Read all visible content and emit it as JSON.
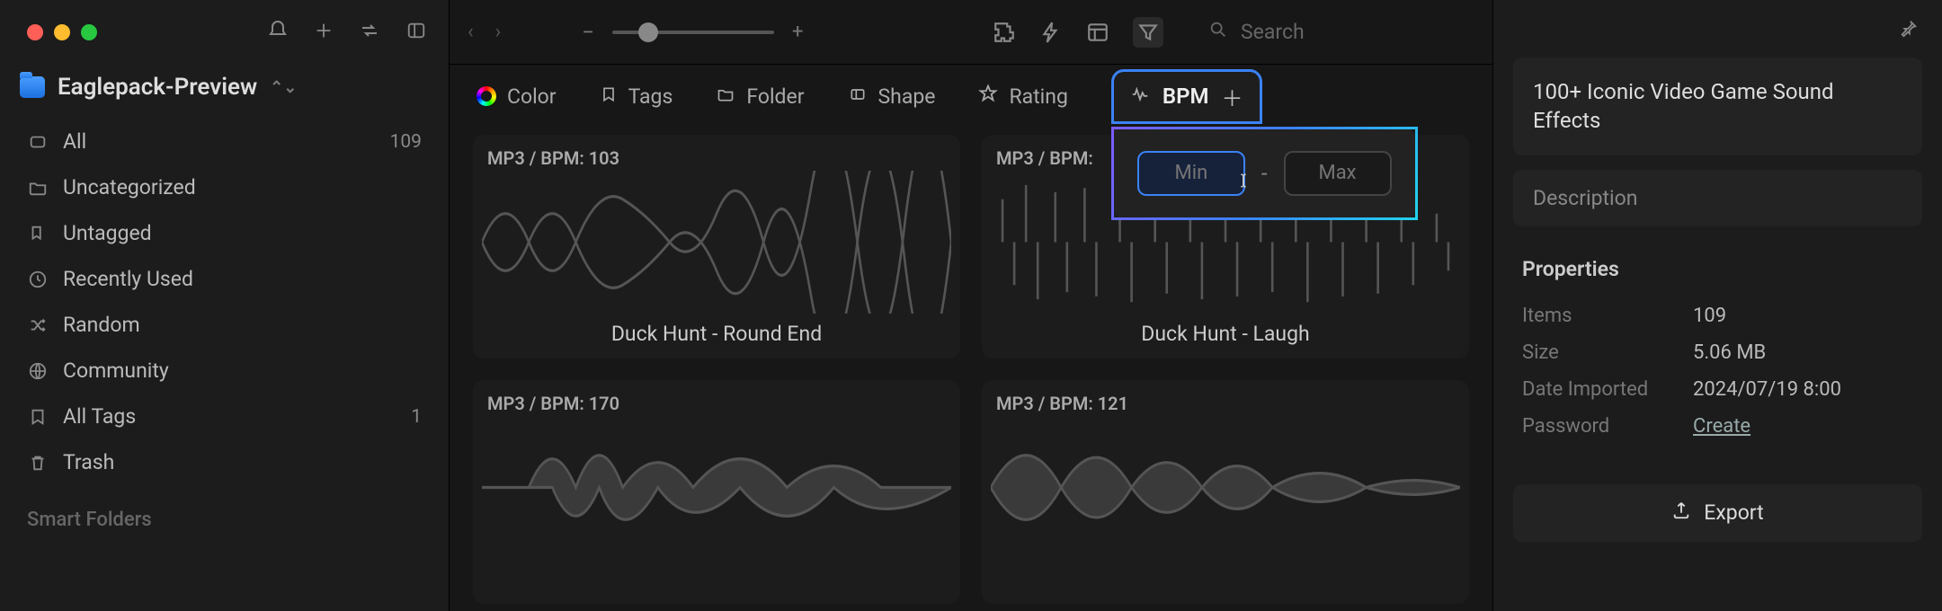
{
  "library": {
    "name": "Eaglepack-Preview"
  },
  "sidebar": {
    "items": [
      {
        "label": "All",
        "count": "109"
      },
      {
        "label": "Uncategorized",
        "count": ""
      },
      {
        "label": "Untagged",
        "count": ""
      },
      {
        "label": "Recently Used",
        "count": ""
      },
      {
        "label": "Random",
        "count": ""
      },
      {
        "label": "Community",
        "count": ""
      },
      {
        "label": "All Tags",
        "count": "1"
      },
      {
        "label": "Trash",
        "count": ""
      }
    ],
    "smart_folders_label": "Smart Folders"
  },
  "toolbar": {
    "search_placeholder": "Search",
    "zoom_minus": "−",
    "zoom_plus": "+"
  },
  "filters": {
    "color": "Color",
    "tags": "Tags",
    "folder": "Folder",
    "shape": "Shape",
    "rating": "Rating",
    "bpm": "BPM"
  },
  "bpm_popover": {
    "min_placeholder": "Min",
    "max_placeholder": "Max",
    "dash": "-"
  },
  "grid": [
    {
      "badge": "MP3 / BPM: 103",
      "title": "Duck Hunt - Round End"
    },
    {
      "badge": "MP3 / BPM:",
      "title": "Duck Hunt - Laugh"
    },
    {
      "badge": "MP3 / BPM: 170",
      "title": ""
    },
    {
      "badge": "MP3 / BPM: 121",
      "title": ""
    }
  ],
  "inspector": {
    "title": "100+ Iconic Video Game Sound Effects",
    "description_label": "Description",
    "properties_label": "Properties",
    "items_key": "Items",
    "items_val": "109",
    "size_key": "Size",
    "size_val": "5.06 MB",
    "date_key": "Date Imported",
    "date_val": "2024/07/19 8:00",
    "password_key": "Password",
    "password_val": "Create",
    "export_label": "Export"
  }
}
